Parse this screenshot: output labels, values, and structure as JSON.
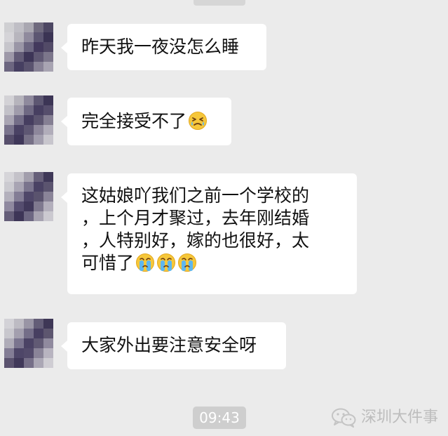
{
  "messages": [
    {
      "avatar_icon": "pixelated-avatar-icon",
      "lines": [
        "昨天我一夜没怎么睡"
      ],
      "emoji": []
    },
    {
      "avatar_icon": "pixelated-avatar-icon",
      "lines": [
        "完全接受不了"
      ],
      "emoji": [
        "crying-face-emoji-icon"
      ]
    },
    {
      "avatar_icon": "pixelated-avatar-icon",
      "lines": [
        "这姑娘吖我们之前一个学校的",
        "，上个月才聚过，去年刚结婚",
        "，人特别好，嫁的也很好，太",
        "可惜了"
      ],
      "emoji": [
        "sobbing-face-emoji-icon",
        "sobbing-face-emoji-icon",
        "sobbing-face-emoji-icon"
      ]
    },
    {
      "avatar_icon": "pixelated-avatar-icon",
      "lines": [
        "大家外出要注意安全呀"
      ],
      "emoji": []
    }
  ],
  "timestamp": "09:43",
  "watermark": {
    "icon": "wechat-logo-icon",
    "text": "深圳大件事"
  },
  "colors": {
    "background": "#ebebeb",
    "bubble": "#ffffff",
    "timestamp_pill": "#cecece"
  }
}
